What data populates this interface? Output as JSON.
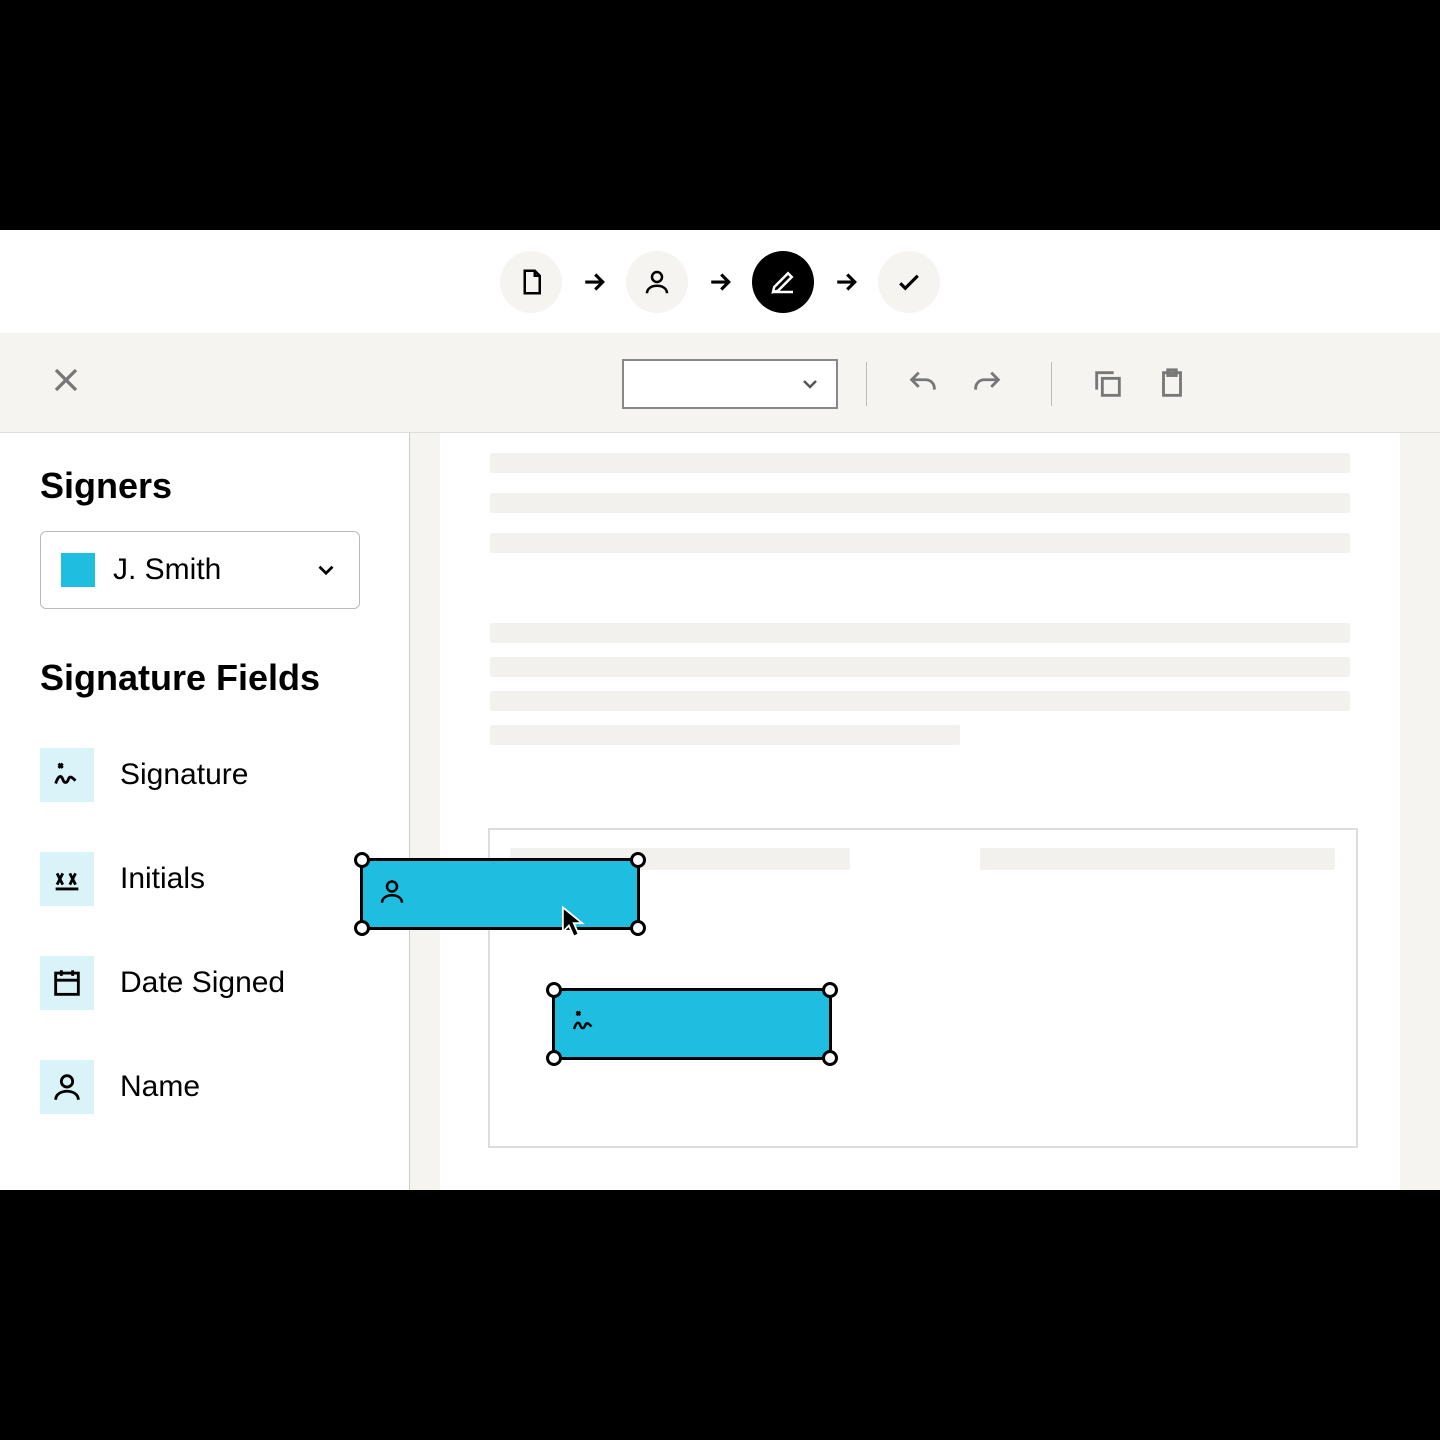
{
  "colors": {
    "accent": "#1fbde0",
    "field_icon_bg": "#d9f3f9"
  },
  "steps": [
    {
      "icon": "document-icon",
      "active": false
    },
    {
      "icon": "person-icon",
      "active": false
    },
    {
      "icon": "edit-icon",
      "active": true
    },
    {
      "icon": "check-icon",
      "active": false
    }
  ],
  "toolbar": {
    "select_value": "",
    "actions": [
      "undo",
      "redo",
      "copy",
      "paste"
    ]
  },
  "sidebar": {
    "signers_heading": "Signers",
    "signer_selected": "J. Smith",
    "fields_heading": "Signature Fields",
    "fields": [
      {
        "key": "signature",
        "label": "Signature",
        "icon": "signature-icon"
      },
      {
        "key": "initials",
        "label": "Initials",
        "icon": "initials-icon"
      },
      {
        "key": "date",
        "label": "Date Signed",
        "icon": "date-icon"
      },
      {
        "key": "name",
        "label": "Name",
        "icon": "person-icon"
      }
    ]
  },
  "canvas": {
    "dropped_fields": [
      {
        "type": "name",
        "icon": "person-icon"
      },
      {
        "type": "signature",
        "icon": "signature-icon"
      }
    ]
  }
}
